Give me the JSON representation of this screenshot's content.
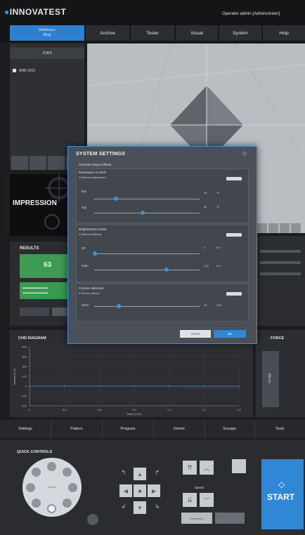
{
  "header": {
    "logo": "INNOVATEST",
    "operator": "Operator admin   [Administrator]",
    "nav": {
      "home_line1": "Hardness",
      "home_line2": "Blog",
      "items": [
        "Archive",
        "Tester",
        "Visual",
        "System",
        "Help"
      ]
    }
  },
  "left": {
    "jobs_title": "JOBS",
    "job_item": "ANN 1012",
    "impression_label": "IMPRESSION",
    "results_title": "RESULTS",
    "result_value": "63"
  },
  "modal": {
    "title": "SYSTEM SETTINGS",
    "tabs": "General   Output   Offsets",
    "illumination": {
      "title": "Illumination Control",
      "checkbox": "Manual adjustment",
      "rows": [
        {
          "label": "Bot",
          "value": "30",
          "extra": "%"
        },
        {
          "label": "Top",
          "value": "50",
          "extra": "%"
        }
      ]
    },
    "brightness": {
      "title": "Brightness/Contrast",
      "checkbox": "Manual settings",
      "rows": [
        {
          "label": "Sh",
          "value": "0",
          "extra": "0.0"
        },
        {
          "label": "Gain",
          "value": "176",
          "extra": "0.0"
        }
      ]
    },
    "detection": {
      "title": "Contour detection",
      "checkbox": "Show contour",
      "rows": [
        {
          "label": "Sens",
          "value": "15",
          "extra": "100"
        }
      ]
    },
    "buttons": {
      "reset": "Reset",
      "ok": "OK"
    }
  },
  "diagram": {
    "title": "CHD DIAGRAM",
    "force_title": "FORCE",
    "force_value": "0.5 kgf"
  },
  "toolbar": [
    "Settings",
    "Pattern",
    "Program",
    "Delete",
    "Escape",
    "Tools"
  ],
  "quick": {
    "title": "QUICK CONTROLS",
    "turret_center": "Home",
    "speed_label": "Speed",
    "start_label": "START",
    "bottom_btn": "Autofocus"
  },
  "chart_data": {
    "type": "line",
    "title": "CHD DIAGRAM",
    "xlabel": "Depth (mm)",
    "ylabel": "Hardness HV",
    "x_ticks": [
      "0",
      "0.3",
      "0.6",
      "0.9",
      "1.2",
      "1.5",
      "1.8"
    ],
    "y_ticks": [
      "400",
      "300",
      "200",
      "100",
      "0",
      "-100",
      "-200"
    ],
    "series": [
      {
        "x": [
          0,
          0.3,
          0.6,
          0.9,
          1.2,
          1.5,
          1.8
        ],
        "y": [
          0,
          0,
          0,
          0,
          0,
          0,
          0
        ]
      }
    ],
    "xlim": [
      0,
      1.8
    ],
    "ylim": [
      -200,
      400
    ],
    "colors": {
      "line": "#3b93de",
      "limit": "#c94848"
    }
  }
}
